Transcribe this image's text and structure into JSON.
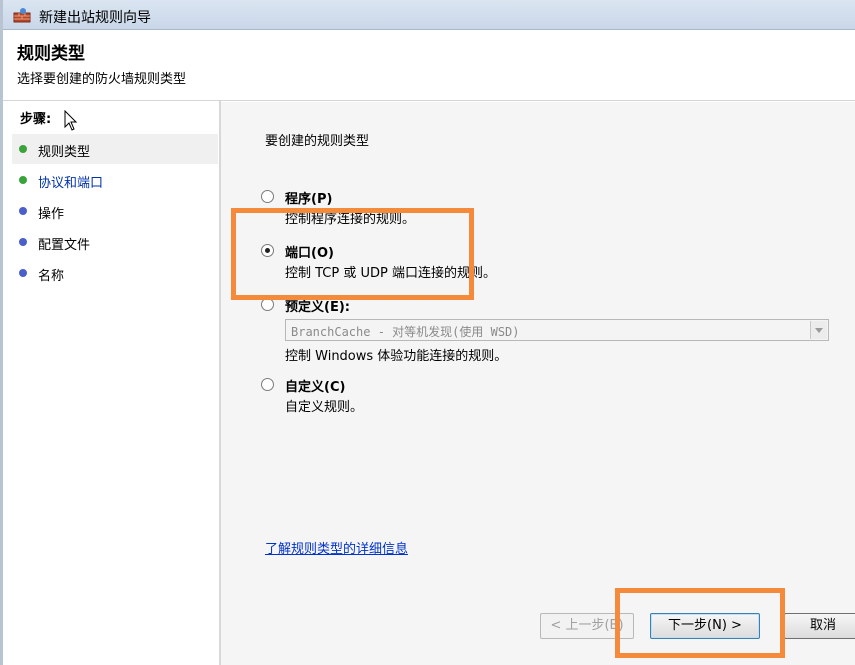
{
  "window": {
    "title": "新建出站规则向导",
    "icon": "firewall-wizard-icon"
  },
  "header": {
    "title": "规则类型",
    "subtitle": "选择要创建的防火墙规则类型"
  },
  "sidebar": {
    "steps_label": "步骤:",
    "items": [
      {
        "label": "规则类型",
        "state": "current",
        "dot_color": "#3aa33a"
      },
      {
        "label": "协议和端口",
        "state": "next",
        "dot_color": "#3aa33a"
      },
      {
        "label": "操作",
        "state": "pending",
        "dot_color": "#4a5fc9"
      },
      {
        "label": "配置文件",
        "state": "pending",
        "dot_color": "#4a5fc9"
      },
      {
        "label": "名称",
        "state": "pending",
        "dot_color": "#4a5fc9"
      }
    ]
  },
  "main": {
    "question": "要创建的规则类型",
    "options": [
      {
        "title": "程序(P)",
        "desc": "控制程序连接的规则。",
        "checked": false
      },
      {
        "title": "端口(O)",
        "desc": "控制 TCP 或 UDP 端口连接的规则。",
        "checked": true
      },
      {
        "title": "预定义(E):",
        "desc": "",
        "checked": false
      },
      {
        "title": "自定义(C)",
        "desc": "自定义规则。",
        "checked": false
      }
    ],
    "predefined_select": {
      "value": "BranchCache - 对等机发现(使用 WSD)"
    },
    "predefined_desc": "控制 Windows 体验功能连接的规则。",
    "learn_more_link": "了解规则类型的详细信息"
  },
  "buttons": {
    "back": "< 上一步(B)",
    "next": "下一步(N) >",
    "cancel": "取消"
  },
  "colors": {
    "highlight": "#f58a3a",
    "link": "#0033cc"
  }
}
